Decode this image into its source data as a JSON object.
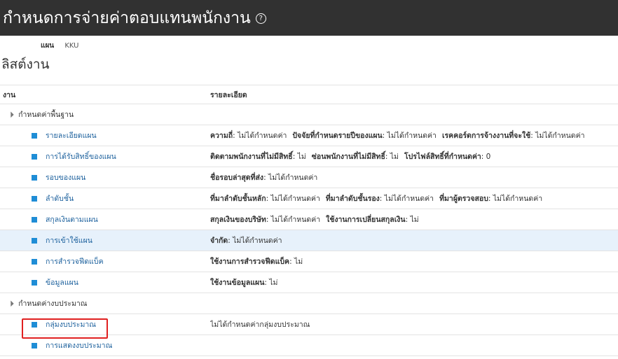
{
  "header": {
    "title": "กำหนดการจ่ายค่าตอบแทนพนักงาน",
    "help_icon": "help-icon"
  },
  "plan": {
    "label": "แผน",
    "value": "KKU"
  },
  "page": {
    "title": "ลิสต์งาน"
  },
  "table": {
    "columns": {
      "task": "งาน",
      "details": "รายละเอียด"
    },
    "groups": [
      {
        "label": "กำหนดค่าพื้นฐาน",
        "tasks": [
          {
            "name": "รายละเอียดแผน",
            "details": [
              {
                "label": "ความถี่",
                "value": ": ไม่ได้กำหนดค่า"
              },
              {
                "label": "ปัจจัยที่กำหนดรายปีของแผน",
                "value": ": ไม่ได้กำหนดค่า"
              },
              {
                "label": "เรคคอร์ดการจ้างงานที่จะใช้",
                "value": ": ไม่ได้กำหนดค่า"
              }
            ]
          },
          {
            "name": "การได้รับสิทธิ์ของแผน",
            "details": [
              {
                "label": "ติดตามพนักงานที่ไม่มีสิทธิ์",
                "value": ": ไม่"
              },
              {
                "label": "ซ่อนพนักงานที่ไม่มีสิทธิ์",
                "value": ": ไม่"
              },
              {
                "label": "โปรไฟล์สิทธิ์ที่กำหนดค่า",
                "value": ": 0"
              }
            ]
          },
          {
            "name": "รอบของแผน",
            "details": [
              {
                "label": "ชื่อรอบล่าสุดที่ส่ง",
                "value": ": ไม่ได้กำหนดค่า"
              }
            ]
          },
          {
            "name": "ลำดับชั้น",
            "details": [
              {
                "label": "ที่มาลำดับชั้นหลัก",
                "value": ": ไม่ได้กำหนดค่า"
              },
              {
                "label": "ที่มาลำดับชั้นรอง",
                "value": ": ไม่ได้กำหนดค่า"
              },
              {
                "label": "ที่มาผู้ตรวจสอบ",
                "value": ": ไม่ได้กำหนดค่า"
              }
            ]
          },
          {
            "name": "สกุลเงินตามแผน",
            "details": [
              {
                "label": "สกุลเงินของบริษัท",
                "value": ": ไม่ได้กำหนดค่า"
              },
              {
                "label": "ใช้งานการเปลี่ยนสกุลเงิน",
                "value": ": ไม่"
              }
            ]
          },
          {
            "name": "การเข้าใช้แผน",
            "selected": true,
            "details": [
              {
                "label": "จำกัด",
                "value": ": ไม่ได้กำหนดค่า"
              }
            ]
          },
          {
            "name": "การสำรวจฟีดแบ็ค",
            "details": [
              {
                "label": "ใช้งานการสำรวจฟีดแบ็ค",
                "value": ": ไม่"
              }
            ]
          },
          {
            "name": "ข้อมูลแผน",
            "details": [
              {
                "label": "ใช้งานข้อมูลแผน",
                "value": ": ไม่"
              }
            ]
          }
        ]
      },
      {
        "label": "กำหนดค่างบประมาณ",
        "tasks": [
          {
            "name": "กลุ่มงบประมาณ",
            "highlighted": true,
            "details": [
              {
                "label": "",
                "value": "ไม่ได้กำหนดค่ากลุ่มงบประมาณ"
              }
            ]
          },
          {
            "name": "การแสดงงบประมาณ",
            "details": []
          }
        ]
      }
    ]
  },
  "colors": {
    "header_bg": "#313131",
    "link": "#1a5f9c",
    "task_icon": "#1f8dd6",
    "selected_row": "#e7f1fb",
    "highlight": "#e02020"
  }
}
